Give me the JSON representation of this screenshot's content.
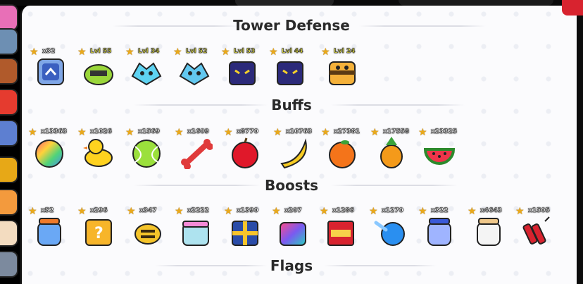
{
  "sections": {
    "tower_defense": {
      "title": "Tower Defense"
    },
    "buffs": {
      "title": "Buffs"
    },
    "boosts": {
      "title": "Boosts"
    },
    "flags": {
      "title": "Flags"
    }
  },
  "tower_defense_items": [
    {
      "name": "tower-tile",
      "qty": "x32"
    },
    {
      "name": "green-tower",
      "qty": "Lvl 55"
    },
    {
      "name": "blue-bird-tower",
      "qty": "Lvl 34"
    },
    {
      "name": "blue-bird-tower-2",
      "qty": "Lvl 52"
    },
    {
      "name": "dark-cube-tower",
      "qty": "Lvl 53"
    },
    {
      "name": "dark-cube-tower-2",
      "qty": "Lvl 44"
    },
    {
      "name": "bee-tower",
      "qty": "Lvl 24"
    }
  ],
  "buff_items": [
    {
      "name": "rainbow-fruit",
      "qty": "x13363"
    },
    {
      "name": "rubber-duck",
      "qty": "x1026"
    },
    {
      "name": "tennis-ball",
      "qty": "x1569"
    },
    {
      "name": "bone",
      "qty": "x1609"
    },
    {
      "name": "apple",
      "qty": "x8770"
    },
    {
      "name": "banana",
      "qty": "x10763"
    },
    {
      "name": "orange",
      "qty": "x27381"
    },
    {
      "name": "pineapple",
      "qty": "x17558"
    },
    {
      "name": "watermelon",
      "qty": "x23325"
    }
  ],
  "boost_items": [
    {
      "name": "blue-potion-jar",
      "qty": "x52"
    },
    {
      "name": "lucky-block",
      "qty": "x296"
    },
    {
      "name": "golden-bee-boost",
      "qty": "x347"
    },
    {
      "name": "gift-box-boost",
      "qty": "x2222"
    },
    {
      "name": "mystery-gift-box",
      "qty": "x1390"
    },
    {
      "name": "rainbow-gift",
      "qty": "x207"
    },
    {
      "name": "tnt-crate",
      "qty": "x1286"
    },
    {
      "name": "blue-comet",
      "qty": "x1270"
    },
    {
      "name": "blue-jar",
      "qty": "x322"
    },
    {
      "name": "white-jar",
      "qty": "x4643"
    },
    {
      "name": "dynamite",
      "qty": "x1505"
    }
  ],
  "colors": {
    "panel": "#fbfbfd",
    "title": "#2a2a2a",
    "star": "#e9a91b",
    "accent_red": "#d8232f"
  }
}
